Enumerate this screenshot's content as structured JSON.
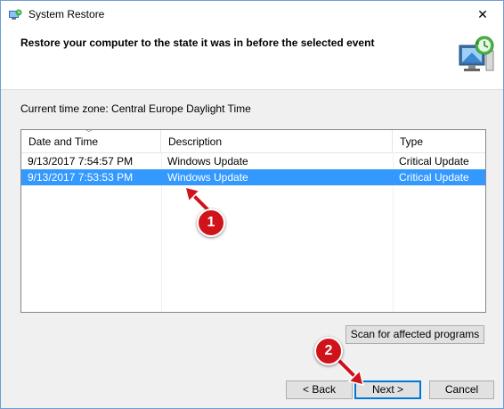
{
  "window": {
    "title": "System Restore",
    "close_glyph": "✕"
  },
  "header": {
    "instruction": "Restore your computer to the state it was in before the selected event",
    "icon": "system-restore-icon"
  },
  "timezone": {
    "label": "Current time zone: Central Europe Daylight Time"
  },
  "table": {
    "columns": [
      "Date and Time",
      "Description",
      "Type"
    ],
    "rows": [
      {
        "datetime": "9/13/2017 7:54:57 PM",
        "description": "Windows Update",
        "type": "Critical Update",
        "selected": false
      },
      {
        "datetime": "9/13/2017 7:53:53 PM",
        "description": "Windows Update",
        "type": "Critical Update",
        "selected": true
      }
    ]
  },
  "buttons": {
    "scan": "Scan for affected programs",
    "back": "< Back",
    "next": "Next >",
    "cancel": "Cancel"
  },
  "annotations": {
    "marker1": "1",
    "marker2": "2"
  },
  "colors": {
    "selection": "#3399ff",
    "annotation": "#d0121b",
    "accent": "#0078d7"
  }
}
